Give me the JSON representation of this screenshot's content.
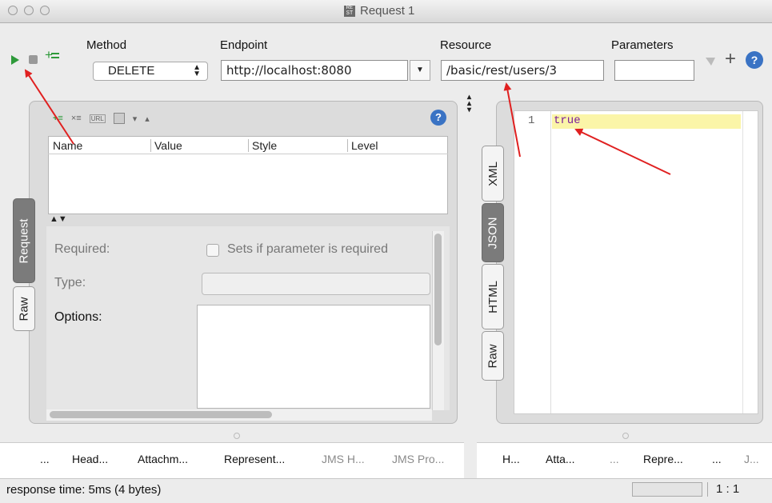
{
  "window": {
    "title": "Request 1",
    "logo_text": "RE ST"
  },
  "toolbar": {
    "method_label": "Method",
    "method_value": "DELETE",
    "endpoint_label": "Endpoint",
    "endpoint_value": "http://localhost:8080",
    "resource_label": "Resource",
    "resource_value": "/basic/rest/users/3",
    "parameters_label": "Parameters",
    "parameters_value": ""
  },
  "params_table": {
    "columns": [
      "Name",
      "Value",
      "Style",
      "Level"
    ]
  },
  "param_detail": {
    "required_label": "Required:",
    "required_checkbox_label": "Sets if parameter is required",
    "type_label": "Type:",
    "options_label": "Options:"
  },
  "left_vtabs": [
    "Request",
    "Raw"
  ],
  "right_vtabs": [
    "XML",
    "JSON",
    "HTML",
    "Raw"
  ],
  "response": {
    "line_number": "1",
    "content": "true"
  },
  "left_bottom_tabs": [
    "...",
    "Head...",
    "Attachm...",
    "Represent...",
    "JMS H...",
    "JMS Pro..."
  ],
  "right_bottom_tabs": [
    "H...",
    "Atta...",
    "...",
    "Repre...",
    "...",
    "J..."
  ],
  "status": {
    "text": "response time: 5ms (4 bytes)",
    "position": "1 : 1"
  },
  "colors": {
    "run_green": "#2e9a3a",
    "annotation_red": "#e02020",
    "highlight": "#fbf5a8",
    "help_blue": "#3a73c4"
  }
}
